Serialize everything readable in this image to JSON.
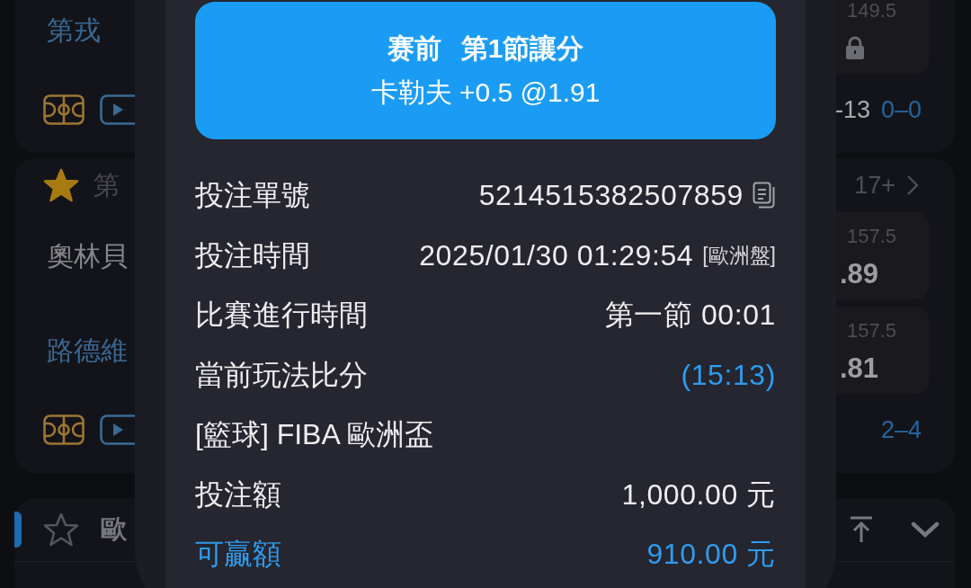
{
  "match_list": [
    {
      "teams": [
        {
          "name": "第戎",
          "highlighted": true
        }
      ],
      "odds": [
        {
          "line": "149.5",
          "locked": true
        }
      ],
      "score_detail": "-13",
      "score": "0–0"
    },
    {
      "starred": true,
      "league": "第",
      "more_count": "17+",
      "teams": [
        {
          "name": "奧林貝",
          "highlighted": false
        },
        {
          "name": "路德維",
          "highlighted": true
        }
      ],
      "odds": [
        {
          "line": "157.5",
          "price": ".89",
          "locked": false
        },
        {
          "line": "157.5",
          "price": ".81",
          "locked": false
        }
      ],
      "score": "2–4"
    }
  ],
  "league_header": {
    "starred": false,
    "title": "歐"
  },
  "bet_slip": {
    "header": {
      "status": "赛前",
      "market": "第1節讓分",
      "selection": "卡勒夫 +0.5 @1.91"
    },
    "rows": [
      {
        "kind": "copy",
        "label": "投注單號",
        "value": "5214515382507859"
      },
      {
        "kind": "tagged",
        "label": "投注時間",
        "value": "2025/01/30 01:29:54",
        "tag": "[歐洲盤]"
      },
      {
        "kind": "plain",
        "label": "比賽進行時間",
        "value": "第一節 00:01"
      },
      {
        "kind": "score",
        "label": "當前玩法比分",
        "value": "(15:13)"
      },
      {
        "kind": "league",
        "label": "[籃球] FIBA 歐洲盃"
      },
      {
        "kind": "plain",
        "label": "投注額",
        "value": "1,000.00 元"
      },
      {
        "kind": "payout",
        "label": "可贏額",
        "value": "910.00 元"
      }
    ]
  }
}
